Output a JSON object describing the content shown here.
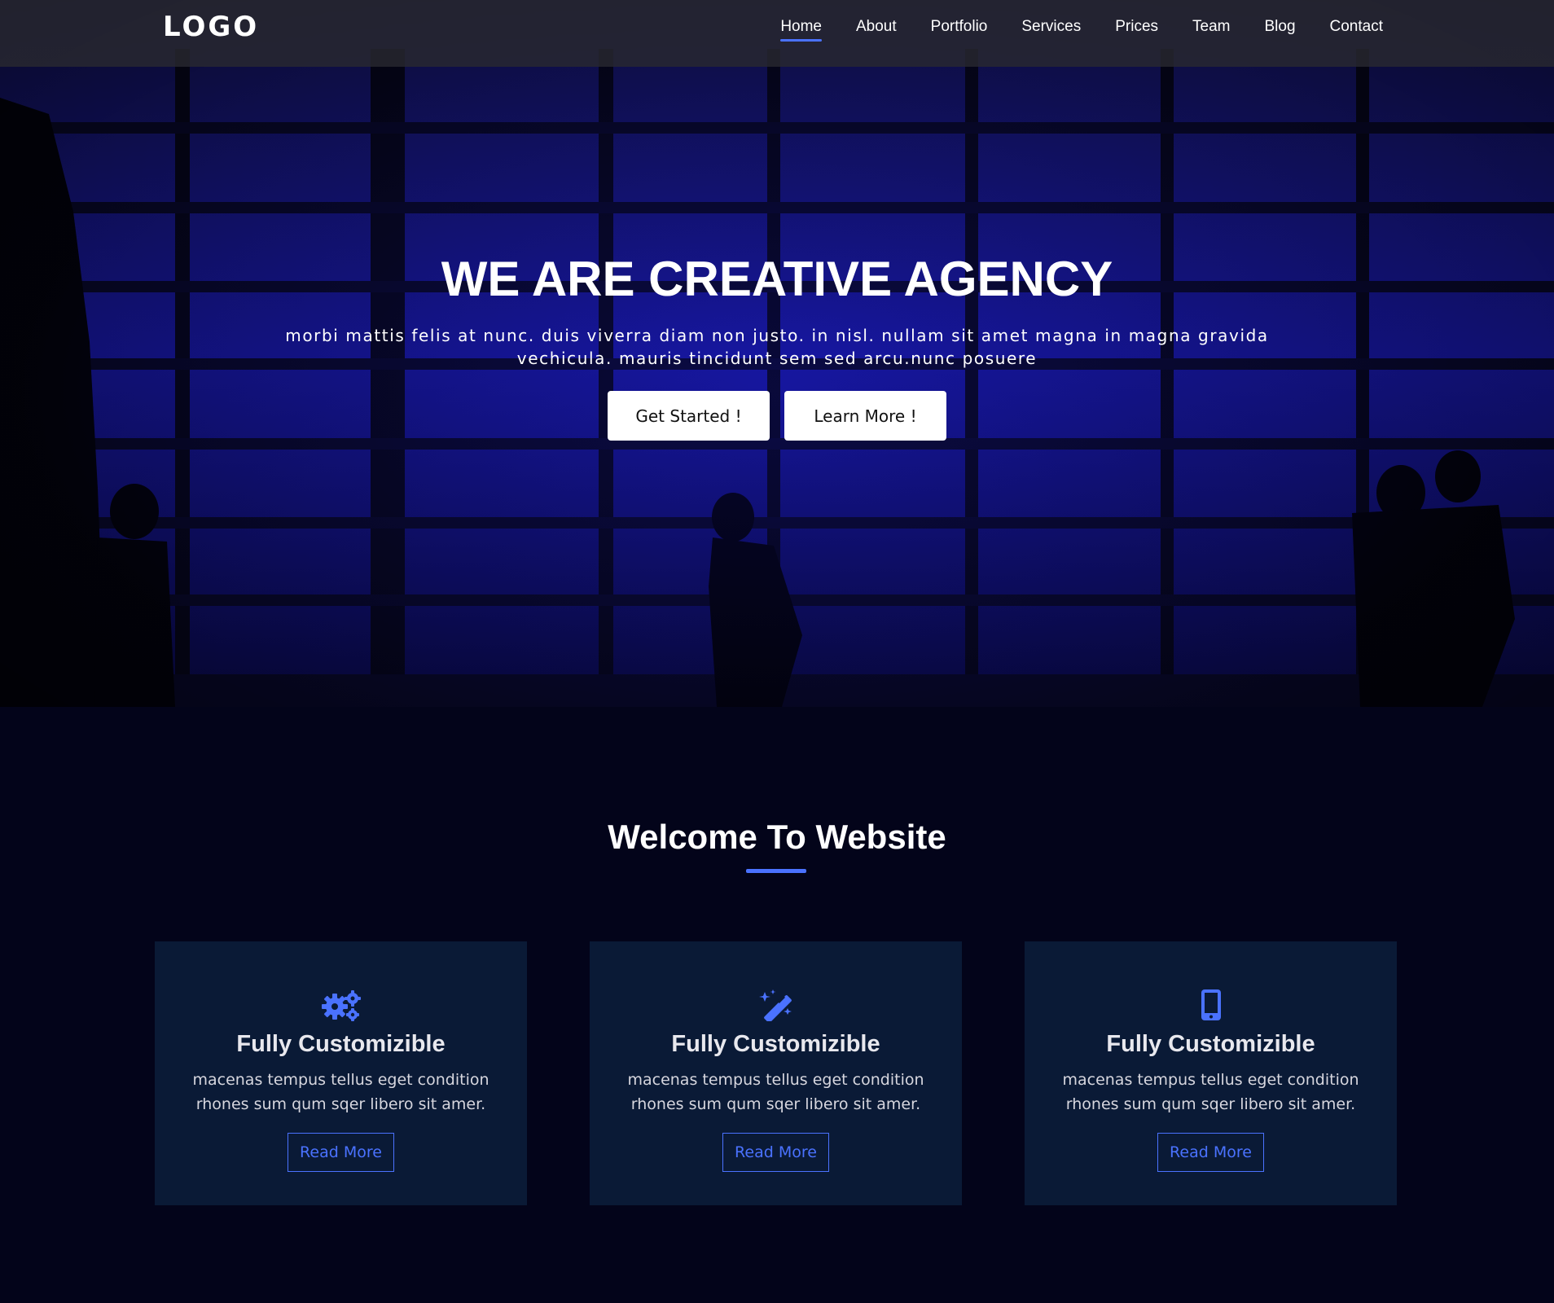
{
  "navbar": {
    "logo": "LOGO",
    "links": [
      "Home",
      "About",
      "Portfolio",
      "Services",
      "Prices",
      "Team",
      "Blog",
      "Contact"
    ],
    "active": "Home"
  },
  "hero": {
    "title": "WE ARE CREATIVE AGENCY",
    "text": "morbi mattis felis at nunc. duis viverra diam non justo. in nisl. nullam sit amet magna in magna gravida vechicula. mauris tincidunt sem sed arcu.nunc posuere",
    "primary_button": "Get Started !",
    "secondary_button": "Learn More !"
  },
  "welcome": {
    "title": "Welcome To Website"
  },
  "cards": [
    {
      "icon": "gears-icon",
      "title": "Fully Customizible",
      "text": "macenas tempus tellus eget condition rhones sum qum sqer libero sit amer.",
      "button": "Read More"
    },
    {
      "icon": "magic-wand-icon",
      "title": "Fully Customizible",
      "text": "macenas tempus tellus eget condition rhones sum qum sqer libero sit amer.",
      "button": "Read More"
    },
    {
      "icon": "mobile-phone-icon",
      "title": "Fully Customizible",
      "text": "macenas tempus tellus eget condition rhones sum qum sqer libero sit amer.",
      "button": "Read More"
    }
  ],
  "colors": {
    "accent": "#4a72ff",
    "page_background": "#03041a",
    "card_background": "#0a1a36"
  }
}
